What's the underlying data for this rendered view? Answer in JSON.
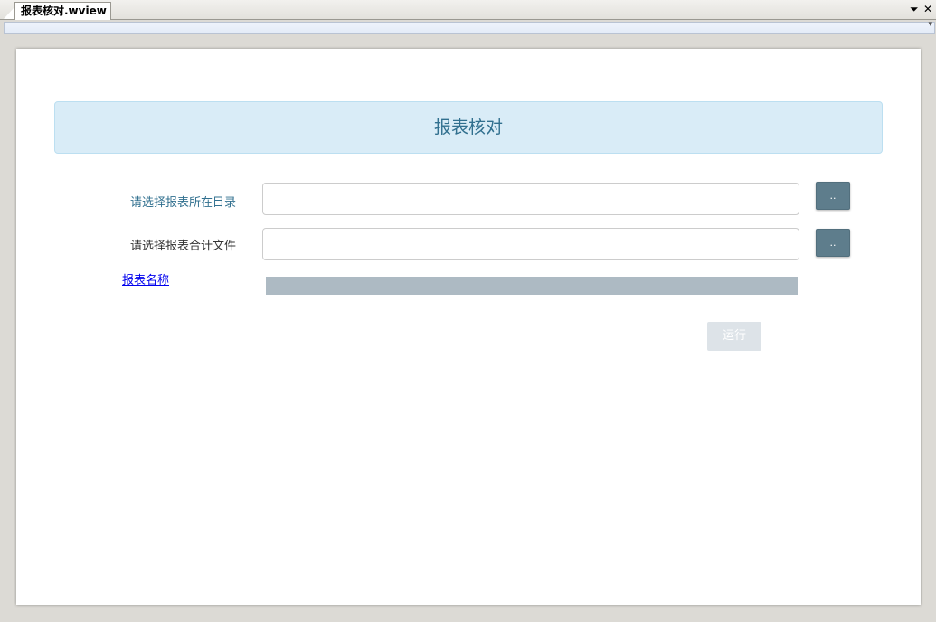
{
  "window": {
    "tab_title": "报表核对.wview",
    "dropdown_glyph": "⏷",
    "close_glyph": "✕"
  },
  "form": {
    "title": "报表核对",
    "directory_label": "请选择报表所在目录",
    "directory_value": "",
    "directory_browse_label": "..",
    "total_file_label": "请选择报表合计文件",
    "total_file_value": "",
    "total_file_browse_label": "..",
    "report_name_link": "报表名称",
    "progress": 1.0,
    "run_label": "运行"
  },
  "colors": {
    "title_bg": "#d9ecf7",
    "title_text": "#31708f",
    "browse_button": "#5e7d8c",
    "progress_fill": "#adbac3",
    "run_button_disabled": "#dde3e8",
    "link": "#0000ee"
  }
}
